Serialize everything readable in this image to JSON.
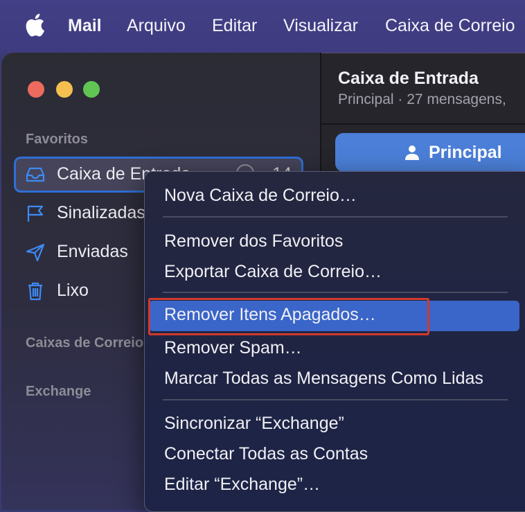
{
  "menubar": {
    "app": "Mail",
    "items": [
      "Arquivo",
      "Editar",
      "Visualizar",
      "Caixa de Correio"
    ]
  },
  "sidebar": {
    "favorites_label": "Favoritos",
    "items": [
      {
        "label": "Caixa de Entrada",
        "count": "14",
        "icon": "inbox-icon",
        "selected": true
      },
      {
        "label": "Sinalizadas",
        "icon": "flag-icon"
      },
      {
        "label": "Enviadas",
        "icon": "paper-plane-icon"
      },
      {
        "label": "Lixo",
        "icon": "trash-icon"
      }
    ],
    "mailboxes_label": "Caixas de Correio",
    "exchange_label": "Exchange"
  },
  "pane": {
    "title": "Caixa de Entrada",
    "subtitle": "Principal · 27 mensagens,",
    "principal_label": "Principal"
  },
  "context_menu": {
    "items": [
      "Nova Caixa de Correio…",
      "Remover dos Favoritos",
      "Exportar Caixa de Correio…",
      "Remover Itens Apagados…",
      "Remover Spam…",
      "Marcar Todas as Mensagens Como Lidas",
      "Sincronizar “Exchange”",
      "Conectar Todas as Contas",
      "Editar “Exchange”…"
    ],
    "highlighted_index": 3
  },
  "colors": {
    "menubar": "#423f86",
    "accent": "#3a65c9",
    "sidebar_icon": "#3d8bf5",
    "annotation": "#d23a2e"
  }
}
